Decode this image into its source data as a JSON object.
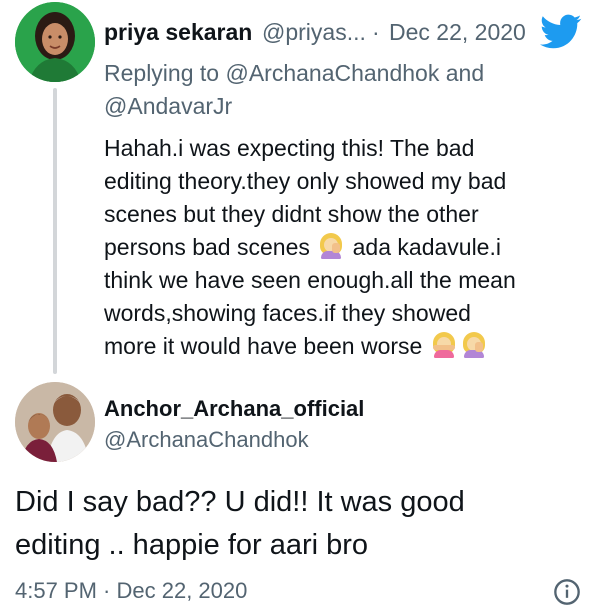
{
  "tweet": {
    "author_name": "priya sekaran",
    "author_handle": "@priyas...",
    "separator": "·",
    "date": "Dec 22, 2020",
    "replying_prefix": "Replying to ",
    "replying_to_1": "@ArchanaChandhok",
    "replying_and": " and",
    "replying_to_2": "@AndavarJr",
    "body_lines": [
      "Hahah.i was expecting this! The bad",
      "editing theory.they only showed my bad",
      "scenes but they didnt show the other",
      "persons bad scenes",
      "ada kadavule.i",
      "think we have seen enough.all the mean",
      "words,showing faces.if they showed",
      "more it would have been worse"
    ]
  },
  "reply": {
    "author_name": "Anchor_Archana_official",
    "author_handle": "@ArchanaChandhok",
    "body_lines": [
      "Did I say bad?? U did!! It was good",
      "editing .. happie for aari bro"
    ],
    "timestamp": "4:57 PM · Dec 22, 2020"
  },
  "icons": {
    "brand": "twitter-bird-icon",
    "info": "info-icon",
    "emoji_facepalm": "woman-facepalming-emoji",
    "emoji_no": "woman-gesturing-no-emoji"
  },
  "colors": {
    "brand_blue": "#1d9bf0",
    "text_primary": "#0f1419",
    "text_secondary": "#536471",
    "thread_line": "#d3d6d9"
  }
}
